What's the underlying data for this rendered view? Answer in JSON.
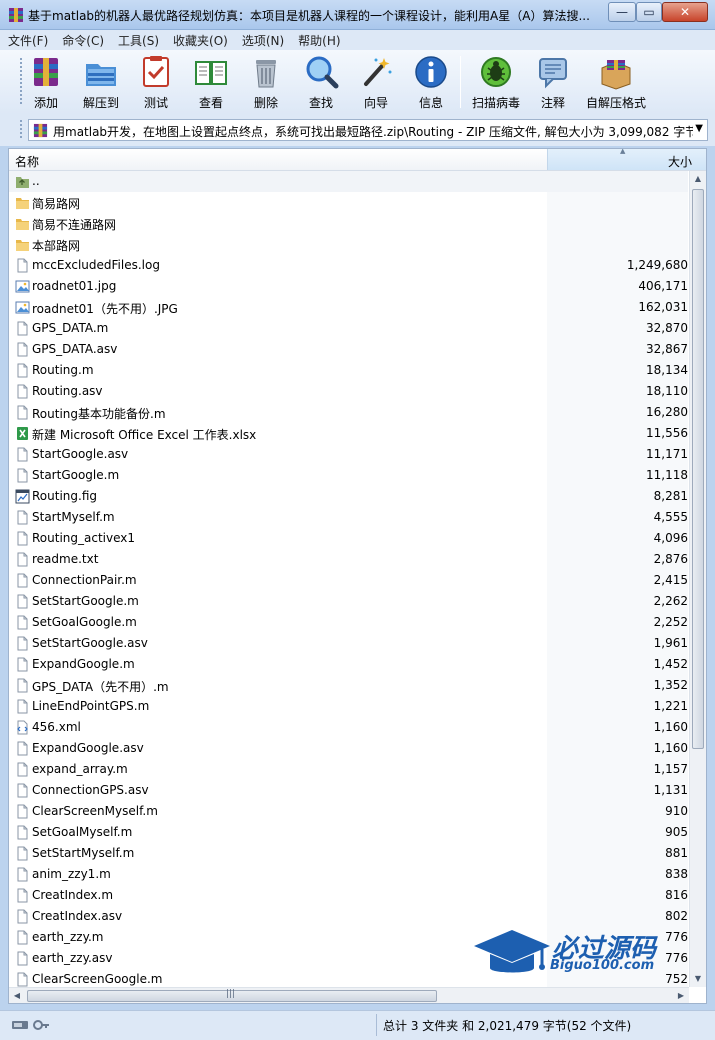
{
  "window": {
    "title": "基于matlab的机器人最优路径规划仿真：本项目是机器人课程的一个课程设计，能利用A星（A）算法搜...",
    "min_glyph": "—",
    "max_glyph": "▭",
    "close_glyph": "✕"
  },
  "menu": [
    "文件(F)",
    "命令(C)",
    "工具(S)",
    "收藏夹(O)",
    "选项(N)",
    "帮助(H)"
  ],
  "toolbar": [
    {
      "label": "添加",
      "icon": "add-archive-icon"
    },
    {
      "label": "解压到",
      "icon": "extract-to-icon"
    },
    {
      "label": "测试",
      "icon": "test-icon"
    },
    {
      "label": "查看",
      "icon": "view-book-icon"
    },
    {
      "label": "删除",
      "icon": "trash-icon"
    },
    {
      "label": "查找",
      "icon": "magnifier-icon"
    },
    {
      "label": "向导",
      "icon": "wizard-wand-icon"
    },
    {
      "label": "信息",
      "icon": "info-icon"
    },
    {
      "label": "扫描病毒",
      "icon": "virus-bug-icon"
    },
    {
      "label": "注释",
      "icon": "comment-icon"
    },
    {
      "label": "自解压格式",
      "icon": "sfx-box-icon"
    }
  ],
  "path": "用matlab开发，在地图上设置起点终点，系统可找出最短路径.zip\\Routing - ZIP 压缩文件, 解包大小为 3,099,082 字节",
  "columns": {
    "name": "名称",
    "size": "大小"
  },
  "files": [
    {
      "name": "..",
      "size": "",
      "type": "parent"
    },
    {
      "name": "简易路网",
      "size": "",
      "type": "folder"
    },
    {
      "name": "简易不连通路网",
      "size": "",
      "type": "folder"
    },
    {
      "name": "本部路网",
      "size": "",
      "type": "folder"
    },
    {
      "name": "mccExcludedFiles.log",
      "size": "1,249,680",
      "type": "file"
    },
    {
      "name": "roadnet01.jpg",
      "size": "406,171",
      "type": "image"
    },
    {
      "name": "roadnet01（先不用）.JPG",
      "size": "162,031",
      "type": "image"
    },
    {
      "name": "GPS_DATA.m",
      "size": "32,870",
      "type": "file"
    },
    {
      "name": "GPS_DATA.asv",
      "size": "32,867",
      "type": "file"
    },
    {
      "name": "Routing.m",
      "size": "18,134",
      "type": "file"
    },
    {
      "name": "Routing.asv",
      "size": "18,110",
      "type": "file"
    },
    {
      "name": "Routing基本功能备份.m",
      "size": "16,280",
      "type": "file"
    },
    {
      "name": "新建 Microsoft Office Excel 工作表.xlsx",
      "size": "11,556",
      "type": "excel"
    },
    {
      "name": "StartGoogle.asv",
      "size": "11,171",
      "type": "file"
    },
    {
      "name": "StartGoogle.m",
      "size": "11,118",
      "type": "file"
    },
    {
      "name": "Routing.fig",
      "size": "8,281",
      "type": "fig"
    },
    {
      "name": "StartMyself.m",
      "size": "4,555",
      "type": "file"
    },
    {
      "name": "Routing_activex1",
      "size": "4,096",
      "type": "file"
    },
    {
      "name": "readme.txt",
      "size": "2,876",
      "type": "file"
    },
    {
      "name": "ConnectionPair.m",
      "size": "2,415",
      "type": "file"
    },
    {
      "name": "SetStartGoogle.m",
      "size": "2,262",
      "type": "file"
    },
    {
      "name": "SetGoalGoogle.m",
      "size": "2,252",
      "type": "file"
    },
    {
      "name": "SetStartGoogle.asv",
      "size": "1,961",
      "type": "file"
    },
    {
      "name": "ExpandGoogle.m",
      "size": "1,452",
      "type": "file"
    },
    {
      "name": "GPS_DATA（先不用）.m",
      "size": "1,352",
      "type": "file"
    },
    {
      "name": "LineEndPointGPS.m",
      "size": "1,221",
      "type": "file"
    },
    {
      "name": "456.xml",
      "size": "1,160",
      "type": "xml"
    },
    {
      "name": "ExpandGoogle.asv",
      "size": "1,160",
      "type": "file"
    },
    {
      "name": "expand_array.m",
      "size": "1,157",
      "type": "file"
    },
    {
      "name": "ConnectionGPS.asv",
      "size": "1,131",
      "type": "file"
    },
    {
      "name": "ClearScreenMyself.m",
      "size": "910",
      "type": "file"
    },
    {
      "name": "SetGoalMyself.m",
      "size": "905",
      "type": "file"
    },
    {
      "name": "SetStartMyself.m",
      "size": "881",
      "type": "file"
    },
    {
      "name": "anim_zzy1.m",
      "size": "838",
      "type": "file"
    },
    {
      "name": "CreatIndex.m",
      "size": "816",
      "type": "file"
    },
    {
      "name": "CreatIndex.asv",
      "size": "802",
      "type": "file"
    },
    {
      "name": "earth_zzy.m",
      "size": "776",
      "type": "file"
    },
    {
      "name": "earth_zzy.asv",
      "size": "776",
      "type": "file"
    },
    {
      "name": "ClearScreenGoogle.m",
      "size": "752",
      "type": "file"
    }
  ],
  "status": "总计 3 文件夹 和 2,021,479 字节(52 个文件)",
  "watermark": {
    "cn": "必过源码",
    "url": "Biguo100.com",
    "color": "#1d5fb0"
  }
}
